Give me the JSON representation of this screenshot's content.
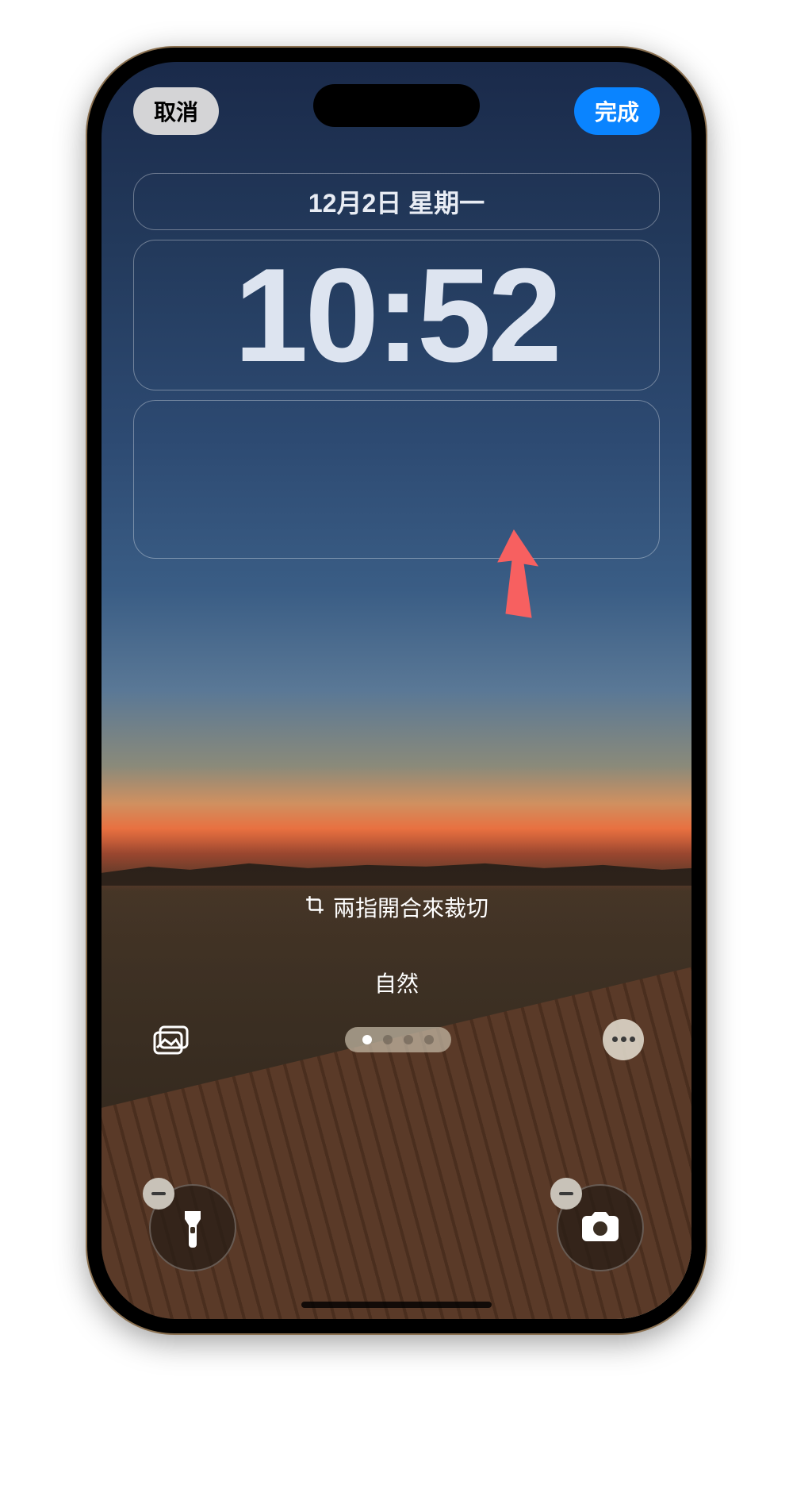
{
  "top_bar": {
    "cancel_label": "取消",
    "done_label": "完成"
  },
  "lock_screen": {
    "date": "12月2日 星期一",
    "time": "10:52"
  },
  "crop_hint": "兩指開合來裁切",
  "filter_label": "自然",
  "bottom_icons": {
    "photos": "photos-icon",
    "more": "more-icon",
    "flashlight": "flashlight-icon",
    "camera": "camera-icon",
    "crop": "crop-icon"
  },
  "page_indicator": {
    "count": 4,
    "active": 0
  }
}
